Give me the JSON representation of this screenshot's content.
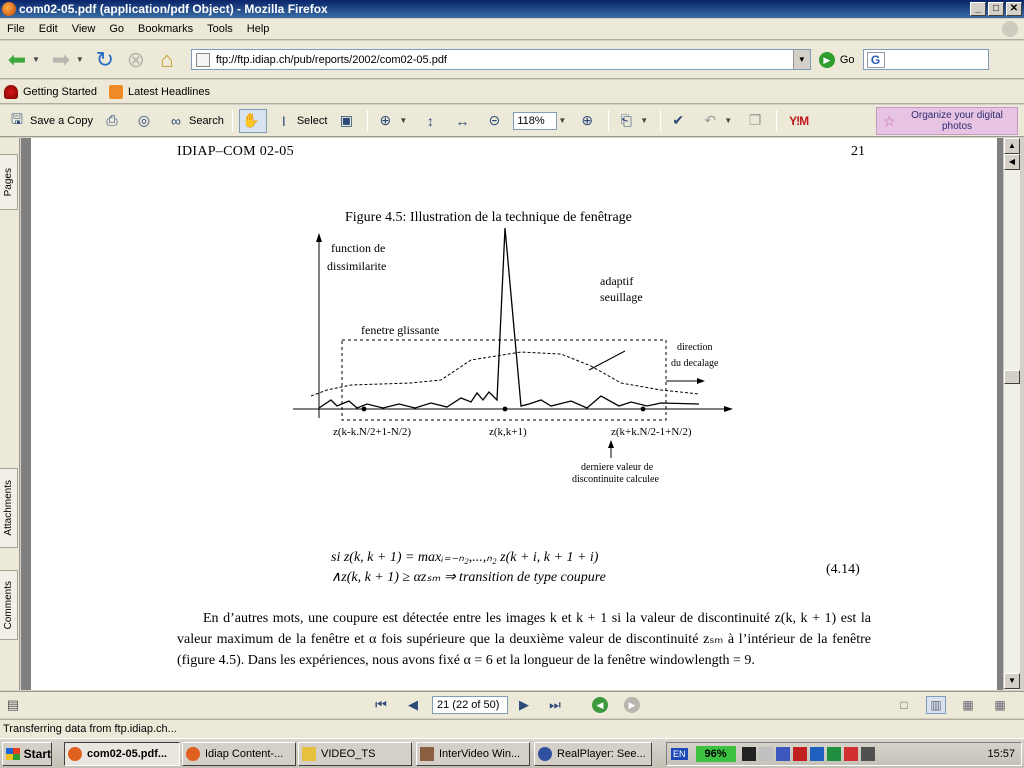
{
  "window": {
    "title": "com02-05.pdf (application/pdf Object) - Mozilla Firefox",
    "controls": {
      "minimize": "_",
      "maximize": "□",
      "close": "✕"
    }
  },
  "menu": [
    "File",
    "Edit",
    "View",
    "Go",
    "Bookmarks",
    "Tools",
    "Help"
  ],
  "navigation": {
    "url": "ftp://ftp.idiap.ch/pub/reports/2002/com02-05.pdf",
    "go_label": "Go",
    "search_logo": "G"
  },
  "bookmarks": [
    {
      "label": "Getting Started",
      "icon": "firefox-hat-icon"
    },
    {
      "label": "Latest Headlines",
      "icon": "rss-icon"
    }
  ],
  "acrobat_toolbar": {
    "save_copy": "Save a Copy",
    "search": "Search",
    "select": "Select",
    "zoom": "118%",
    "yim": "Y!M",
    "organize": "Organize your digital photos"
  },
  "side_tabs": {
    "pages": "Pages",
    "attachments": "Attachments",
    "comments": "Comments"
  },
  "pdf": {
    "running_head": "IDIAP–COM 02-05",
    "page_number": "21",
    "figure_caption": "Figure 4.5: Illustration de la technique de fenêtrage",
    "figure_labels": {
      "y_axis": [
        "function de",
        "dissimilarite"
      ],
      "threshold": [
        "adaptif",
        "seuillage"
      ],
      "window": "fenetre glissante",
      "direction": [
        "direction",
        "du decalage"
      ],
      "left_point": "z(k-k.N/2+1-N/2)",
      "mid_point": "z(k,k+1)",
      "right_point": "z(k+k.N/2-1+N/2)",
      "last_value": [
        "derniere valeur de",
        "discontinuite calculee"
      ]
    },
    "equation_line1": "si z(k, k + 1) = maxᵢ₌₋ₙ₂,...,ₙ₂ z(k + i, k + 1 + i)",
    "equation_line2": "∧z(k, k + 1) ≥ αzₛₘ ⇒ transition de type coupure",
    "equation_number": "(4.14)",
    "paragraph": "En d’autres mots, une coupure est détectée entre les images k et k + 1 si la valeur de discontinuité z(k, k + 1) est la valeur maximum de la fenêtre et α fois supérieure que la deuxième valeur de discontinuité zₛₘ à l’intérieur de la fenêtre (figure 4.5). Dans les expériences, nous avons fixé α = 6 et la longueur de la fenêtre windowlength = 9."
  },
  "page_nav": {
    "page_field": "21 (22 of 50)"
  },
  "status": "Transferring data from ftp.idiap.ch...",
  "taskbar": {
    "start": "Start",
    "tasks": [
      {
        "label": "com02-05.pdf...",
        "active": true,
        "color": "#e06020"
      },
      {
        "label": "Idiap Content-...",
        "active": false,
        "color": "#e06020"
      },
      {
        "label": "VIDEO_TS",
        "active": false,
        "color": "#e8c040"
      },
      {
        "label": "InterVideo Win...",
        "active": false,
        "color": "#8a6040"
      },
      {
        "label": "RealPlayer: See...",
        "active": false,
        "color": "#3050a0"
      }
    ],
    "tray": {
      "language": "EN",
      "battery": "96%",
      "clock": "15:57"
    }
  }
}
